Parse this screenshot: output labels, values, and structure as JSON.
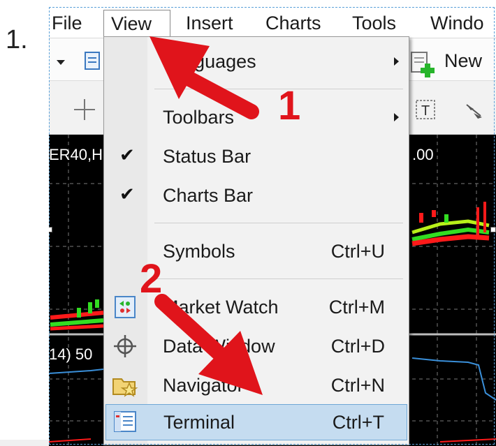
{
  "step_label": "1.",
  "menubar": {
    "items": [
      "File",
      "View",
      "Insert",
      "Charts",
      "Tools",
      "Windo"
    ]
  },
  "toolbar": {
    "new_label": "New"
  },
  "chart": {
    "symbol_label": "ER40,H",
    "price_label": ".00",
    "indicator_label": "14) 50"
  },
  "view_menu": {
    "items": [
      {
        "label": "Languages",
        "shortcut": "",
        "submenu": true
      },
      {
        "label": "Toolbars",
        "shortcut": "",
        "submenu": true
      },
      {
        "label": "Status Bar",
        "shortcut": "",
        "checked": true
      },
      {
        "label": "Charts Bar",
        "shortcut": "",
        "checked": true
      },
      {
        "label": "Symbols",
        "shortcut": "Ctrl+U"
      },
      {
        "label": "Market Watch",
        "shortcut": "Ctrl+M",
        "icon": "market-watch-icon"
      },
      {
        "label": "Data Window",
        "shortcut": "Ctrl+D",
        "icon": "crosshair-icon"
      },
      {
        "label": "Navigator",
        "shortcut": "Ctrl+N",
        "icon": "navigator-folder-icon"
      },
      {
        "label": "Terminal",
        "shortcut": "Ctrl+T",
        "icon": "terminal-icon",
        "highlighted": true
      }
    ]
  },
  "annotations": {
    "step1": "1",
    "step2": "2"
  },
  "colors": {
    "annotation_red": "#e0141b",
    "highlight_blue": "#c5dcf0",
    "chart_background": "#000000",
    "candle_green": "#33dd22",
    "candle_red": "#ff1a1a"
  }
}
